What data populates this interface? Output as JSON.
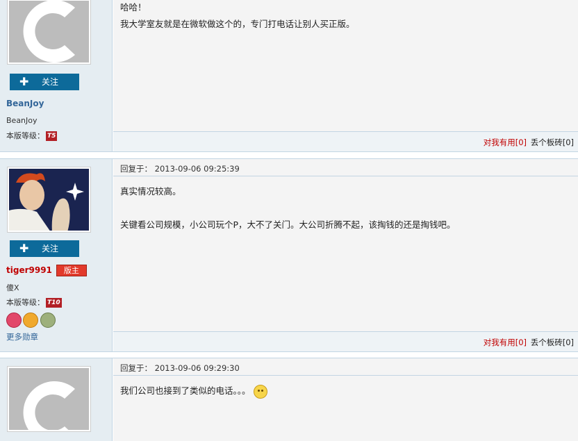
{
  "posts": [
    {
      "user": {
        "name": "BeanJoy",
        "title": "BeanJoy",
        "level_label": "本版等级：",
        "level_badge": "T5",
        "follow_label": "关注",
        "avatar": "default-c-avatar"
      },
      "content": [
        "哈哈！",
        "我大学室友就是在微软做这个的，专门打电话让别人买正版。"
      ],
      "footer": {
        "useful": "对我有用[0]",
        "brick": "丢个板砖[0]"
      }
    },
    {
      "user": {
        "name": "tiger9991",
        "badge": "版主",
        "title": "傻X",
        "level_label": "本版等级：",
        "level_badge": "T10",
        "follow_label": "关注",
        "more_medals": "更多勋章",
        "avatar": "anime-character-avatar"
      },
      "time": "回复于： 2013-09-06 09:25:39",
      "content": [
        "真实情况较高。",
        "",
        "关键看公司规模，小公司玩个P，大不了关门。大公司折腾不起，该掏钱的还是掏钱吧。"
      ],
      "footer": {
        "useful": "对我有用[0]",
        "brick": "丢个板砖[0]"
      }
    },
    {
      "user": {
        "avatar": "default-c-avatar"
      },
      "time": "回复于： 2013-09-06 09:29:30",
      "content": [
        "我们公司也接到了类似的电话。。。"
      ],
      "emoji": "confused-smiley-icon"
    }
  ],
  "colors": {
    "accent": "#0d6a9a",
    "name_blue": "#336699",
    "name_red": "#c00000",
    "border": "#c2d5e3"
  }
}
